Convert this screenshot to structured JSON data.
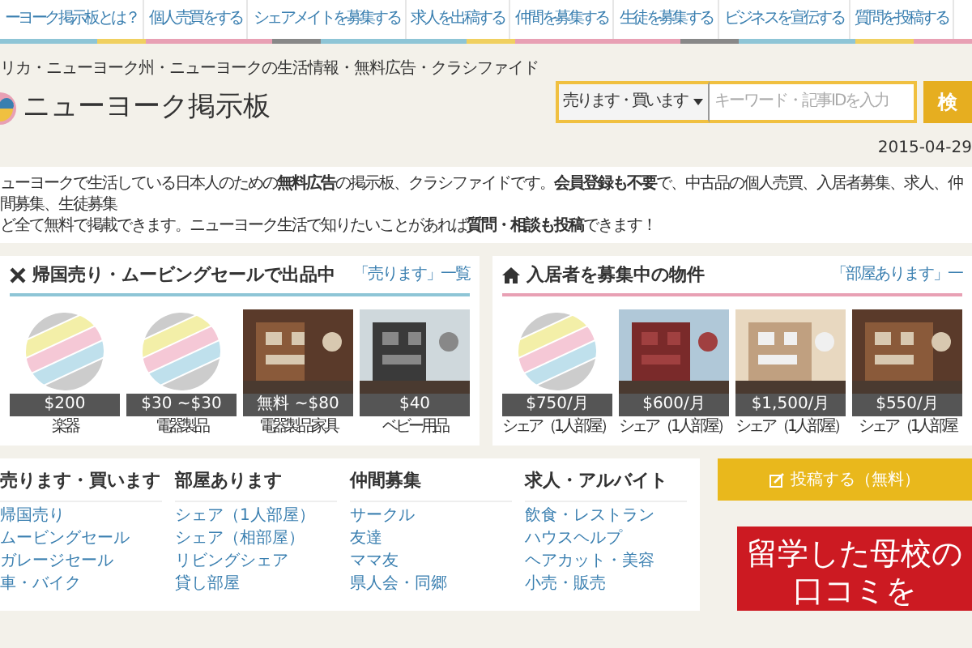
{
  "nav": [
    "ーヨーク掲示板とは？",
    "個人売買をする",
    "シェアメイトを募集する",
    "求人を出稿する",
    "仲間を募集する",
    "生徒を募集する",
    "ビジネスを宣伝する",
    "質問を投稿する"
  ],
  "header": {
    "breadcrumb": "リカ・ニューヨーク州・ニューヨークの生活情報・無料広告・クラシファイド",
    "site_title": "ニューヨーク掲示板",
    "search": {
      "category": "売ります・買います",
      "placeholder": "キーワード・記事IDを入力",
      "button": "検"
    },
    "date": "2015-04-29"
  },
  "intro": [
    "ューヨークで生活している日本人のための**無料広告**の掲示板、クラシファイドです。**会員登録も不要**で、中古品の個人売買、入居者募集、求人、仲間募集、生徒募集",
    "ど全て無料で掲載できます。ニューヨーク生活で知りたいことがあれば**質問・相談も投稿**できます！"
  ],
  "sections": [
    {
      "kind": "sale",
      "title": "帰国売り・ムービングセールで出品中",
      "link": "「売ります」一覧",
      "color": "#8ec5d6",
      "items": [
        {
          "kind": "placeholder",
          "price": "$200",
          "caption": "楽器"
        },
        {
          "kind": "placeholder",
          "price": "$30 ~$30",
          "caption": "電器製品"
        },
        {
          "kind": "picture",
          "price": "無料 ~$80",
          "caption": "電器製品家具"
        },
        {
          "kind": "picture",
          "price": "$40",
          "caption": "ベビー用品"
        }
      ]
    },
    {
      "kind": "room",
      "title": "入居者を募集中の物件",
      "link": "「部屋あります」一",
      "color": "#e8a0b4",
      "items": [
        {
          "kind": "placeholder",
          "price": "$750/月",
          "caption": "シェア（1人部屋）"
        },
        {
          "kind": "picture",
          "price": "$600/月",
          "caption": "シェア（1人部屋）"
        },
        {
          "kind": "picture",
          "price": "$1,500/月",
          "caption": "シェア（1人部屋）"
        },
        {
          "kind": "picture",
          "price": "$550/月",
          "caption": "シェア（1人部屋"
        }
      ]
    }
  ],
  "categories": [
    {
      "title": "売ります・買います",
      "links": [
        "帰国売り",
        "ムービングセール",
        "ガレージセール",
        "車・バイク"
      ]
    },
    {
      "title": "部屋あります",
      "links": [
        "シェア（1人部屋）",
        "シェア（相部屋）",
        "リビングシェア",
        "貸し部屋"
      ]
    },
    {
      "title": "仲間募集",
      "links": [
        "サークル",
        "友達",
        "ママ友",
        "県人会・同郷"
      ]
    },
    {
      "title": "求人・アルバイト",
      "links": [
        "飲食・レストラン",
        "ハウスヘルプ",
        "ヘアカット・美容",
        "小売・販売"
      ]
    }
  ],
  "post_button": "投稿する（無料）",
  "banner": [
    "留学した母校の",
    "口コミを"
  ]
}
